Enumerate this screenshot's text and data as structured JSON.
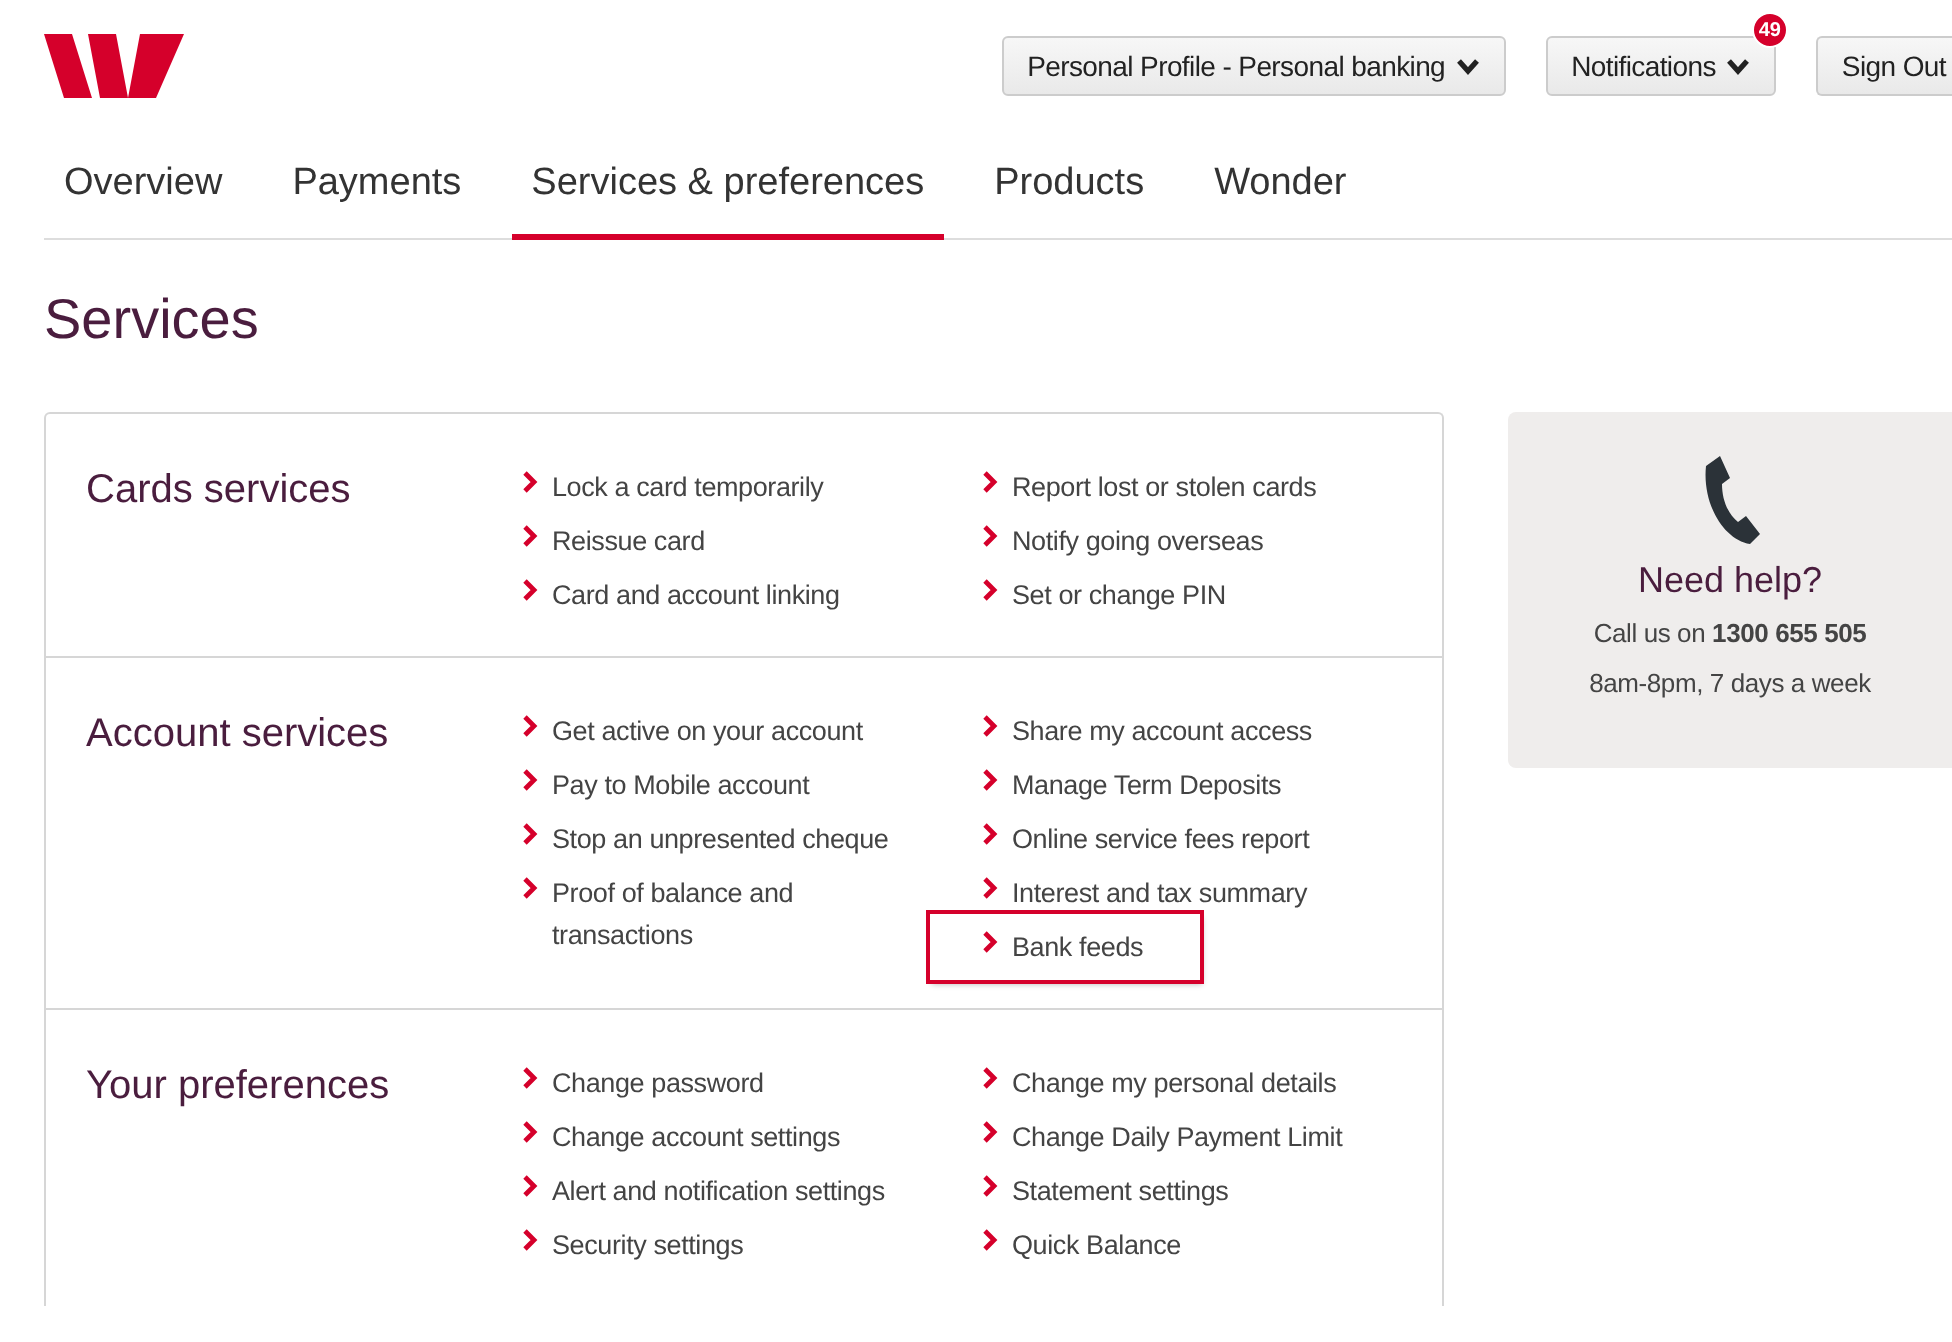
{
  "header": {
    "profile_button": "Personal Profile - Personal banking",
    "notifications_button": "Notifications",
    "notifications_badge": "49",
    "sign_out_button": "Sign Out"
  },
  "tabs": [
    {
      "label": "Overview",
      "selected": false
    },
    {
      "label": "Payments",
      "selected": false
    },
    {
      "label": "Services & preferences",
      "selected": true
    },
    {
      "label": "Products",
      "selected": false
    },
    {
      "label": "Wonder",
      "selected": false
    }
  ],
  "page_title": "Services",
  "sections": [
    {
      "title": "Cards services",
      "columns": [
        [
          {
            "label": "Lock a card temporarily",
            "highlighted": false
          },
          {
            "label": "Reissue card",
            "highlighted": false
          },
          {
            "label": "Card and account linking",
            "highlighted": false
          }
        ],
        [
          {
            "label": "Report lost or stolen cards",
            "highlighted": false
          },
          {
            "label": "Notify going overseas",
            "highlighted": false
          },
          {
            "label": "Set or change PIN",
            "highlighted": false
          }
        ]
      ]
    },
    {
      "title": "Account services",
      "columns": [
        [
          {
            "label": "Get active on your account",
            "highlighted": false
          },
          {
            "label": "Pay to Mobile account",
            "highlighted": false
          },
          {
            "label": "Stop an unpresented cheque",
            "highlighted": false
          },
          {
            "label": "Proof of balance and transactions",
            "highlighted": false
          }
        ],
        [
          {
            "label": "Share my account access",
            "highlighted": false
          },
          {
            "label": "Manage Term Deposits",
            "highlighted": false
          },
          {
            "label": "Online service fees report",
            "highlighted": false
          },
          {
            "label": "Interest and tax summary",
            "highlighted": false
          },
          {
            "label": "Bank feeds",
            "highlighted": true
          }
        ]
      ]
    },
    {
      "title": "Your preferences",
      "columns": [
        [
          {
            "label": "Change password",
            "highlighted": false
          },
          {
            "label": "Change account settings",
            "highlighted": false
          },
          {
            "label": "Alert and notification settings",
            "highlighted": false
          },
          {
            "label": "Security settings",
            "highlighted": false
          }
        ],
        [
          {
            "label": "Change my personal details",
            "highlighted": false
          },
          {
            "label": "Change Daily Payment Limit",
            "highlighted": false
          },
          {
            "label": "Statement settings",
            "highlighted": false
          },
          {
            "label": "Quick Balance",
            "highlighted": false
          }
        ]
      ]
    }
  ],
  "help": {
    "title": "Need help?",
    "call_text": "Call us on **1300 655 505**",
    "hours": "8am-8pm, 7 days a week"
  }
}
